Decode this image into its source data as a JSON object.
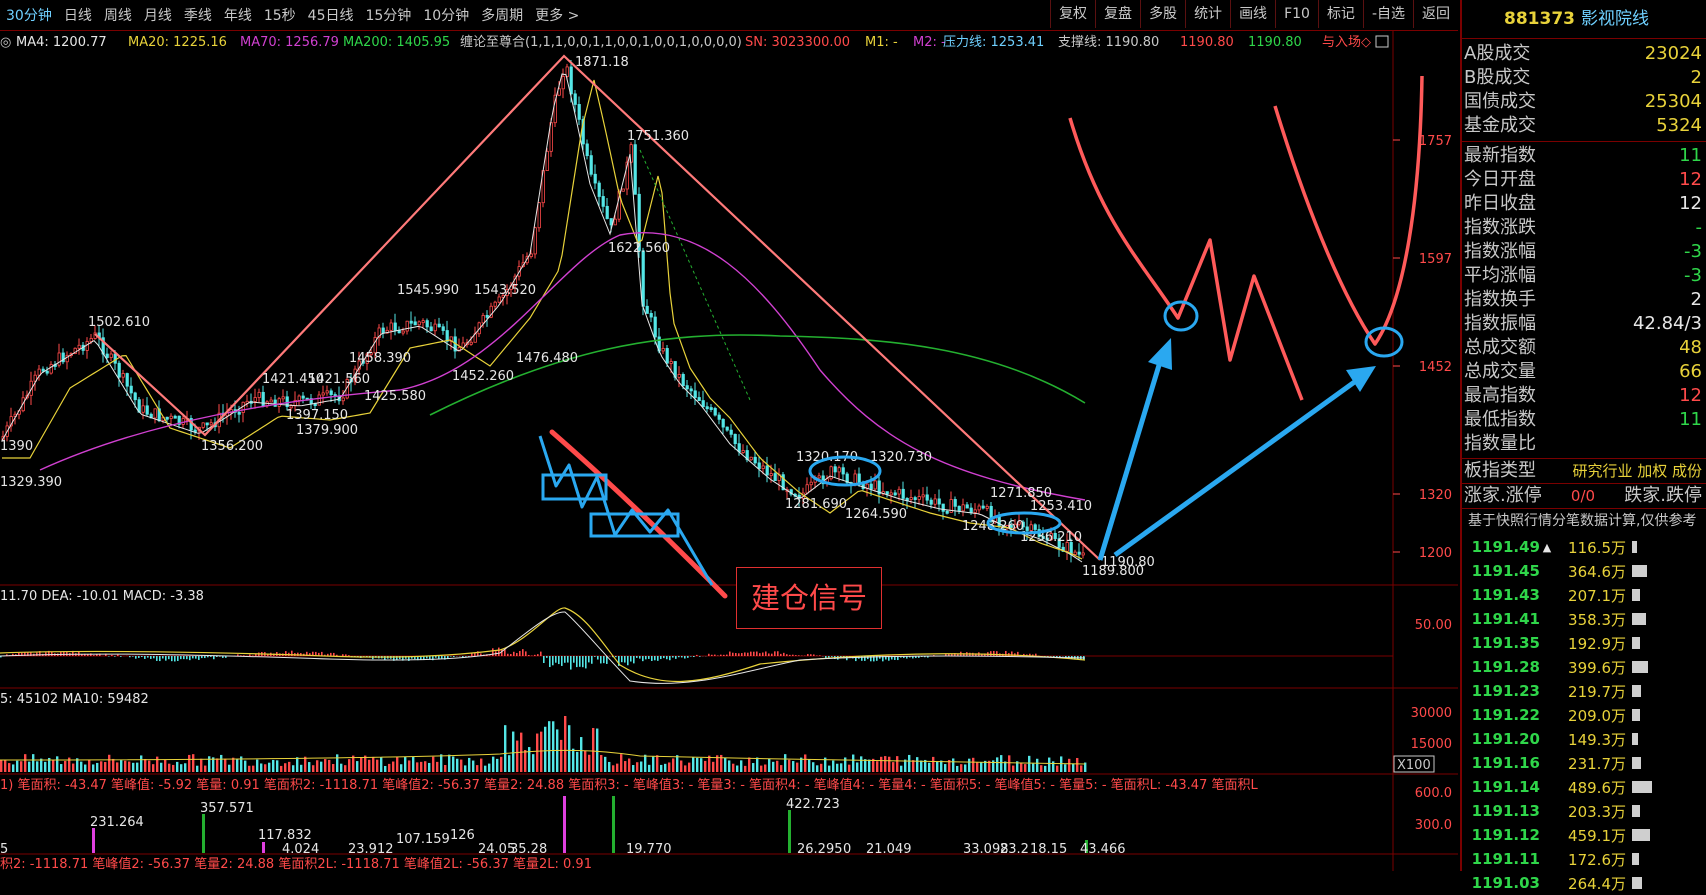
{
  "toolbar": {
    "timeframes": [
      "30分钟",
      "日线",
      "周线",
      "月线",
      "季线",
      "年线",
      "15秒",
      "45日线",
      "15分钟",
      "10分钟",
      "多周期",
      "更多 >"
    ],
    "tools": [
      "复权",
      "复盘",
      "多股",
      "统计",
      "画线",
      "F10",
      "标记",
      "-自选",
      "返回"
    ]
  },
  "indicators": {
    "ma4": "MA4: 1200.77",
    "ma20": "MA20: 1225.16",
    "ma70": "MA70: 1256.79",
    "ma200": "MA200: 1405.95",
    "chanlun": "缠论至尊合(1,1,1,0,0,1,1,0,0,1,0,0,1,0,0,0,0)",
    "sn": "SN: 3023300.00",
    "m1": "M1: -",
    "m2": "M2: -",
    "pressure": "压力线: 1253.41",
    "support": "支撑线: 1190.80",
    "v1": "1190.80",
    "v2": "1190.80",
    "entry": "与入场◇",
    "macd": "11.70 DEA: -10.01  MACD: -3.38",
    "vol": "5: 45102  MA10: 59482",
    "bi": "1)  笔面积: -43.47  笔峰值: -5.92  笔量: 0.91  笔面积2: -1118.71  笔峰值2: -56.37  笔量2: 24.88  笔面积3: -  笔峰值3: -  笔量3: -  笔面积4: -  笔峰值4: -  笔量4: -  笔面积5: -  笔峰值5: -  笔量5: -  笔面积L: -43.47  笔面积L",
    "bottom": "积2: -1118.71  笔峰值2: -56.37  笔量2: 24.88  笔面积2L: -1118.71  笔峰值2L: -56.37  笔量2L: 0.91"
  },
  "axis": {
    "price_ticks": [
      "1757",
      "1597",
      "1452",
      "1320",
      "1200"
    ],
    "macd_tick": "50.00",
    "vol_ticks": [
      "30000",
      "15000"
    ],
    "vol_unit": "X100",
    "bi_ticks": [
      "600.0",
      "300.0"
    ]
  },
  "price_labels": [
    "1871.18",
    "1751.360",
    "1622.560",
    "1545.990",
    "1543.520",
    "1502.610",
    "1458.390",
    "1476.480",
    "1452.260",
    "1425.580",
    "1421.450",
    "1421.560",
    "1397.150",
    "1379.900",
    "1356.200",
    "1390",
    "1329.390",
    "1320.170",
    "1320.730",
    "1281.690",
    "1264.590",
    "1271.850",
    "1253.410",
    "1248.260",
    "1236.210",
    "1190.80",
    "1189.800"
  ],
  "bi_labels": [
    "231.264",
    "357.571",
    "117.832",
    "4.024",
    "23.912",
    "107.159",
    "126",
    "24.05",
    "35.28",
    "422.723",
    "19.770",
    "26.295",
    "0",
    "21.049",
    "33.098",
    "23.2",
    "18.15",
    "43.466",
    "5"
  ],
  "annotation": {
    "signal": "建仓信号"
  },
  "right_panel": {
    "code": "881373",
    "name": "影视院线",
    "market": [
      {
        "label": "A股成交",
        "value": "23024",
        "color": "#e8d23a"
      },
      {
        "label": "B股成交",
        "value": "2",
        "color": "#e8d23a"
      },
      {
        "label": "国债成交",
        "value": "25304",
        "color": "#e8d23a"
      },
      {
        "label": "基金成交",
        "value": "5324",
        "color": "#e8d23a"
      }
    ],
    "index": [
      {
        "label": "最新指数",
        "value": "11",
        "color": "#2fd64a"
      },
      {
        "label": "今日开盘",
        "value": "12",
        "color": "#ff4a4a"
      },
      {
        "label": "昨日收盘",
        "value": "12",
        "color": "#e6e6e6"
      },
      {
        "label": "指数涨跌",
        "value": "-",
        "color": "#2fd64a"
      },
      {
        "label": "指数涨幅",
        "value": "-3",
        "color": "#2fd64a"
      },
      {
        "label": "平均涨幅",
        "value": "-3",
        "color": "#2fd64a"
      },
      {
        "label": "指数换手",
        "value": "2",
        "color": "#e6e6e6"
      },
      {
        "label": "指数振幅",
        "value": "42.84/3",
        "color": "#e6e6e6"
      },
      {
        "label": "总成交额",
        "value": "48",
        "color": "#e8d23a"
      },
      {
        "label": "总成交量",
        "value": "66",
        "color": "#e8d23a"
      },
      {
        "label": "最高指数",
        "value": "12",
        "color": "#ff4a4a"
      },
      {
        "label": "最低指数",
        "value": "11",
        "color": "#2fd64a"
      },
      {
        "label": "指数量比",
        "value": "",
        "color": "#e6e6e6"
      }
    ],
    "board_label": "板指类型",
    "board_value": "研究行业 加权 成份",
    "limit_label": "涨家.涨停",
    "limit_value": "0/0",
    "fall_label": "跌家.跌停",
    "note": "基于快照行情分笔数据计算,仅供参考",
    "ticks": [
      {
        "price": "1191.49",
        "vol": "116.5万",
        "bar": 0.12,
        "arrow": "▲"
      },
      {
        "price": "1191.45",
        "vol": "364.6万",
        "bar": 0.37,
        "arrow": ""
      },
      {
        "price": "1191.43",
        "vol": "207.1万",
        "bar": 0.21,
        "arrow": ""
      },
      {
        "price": "1191.41",
        "vol": "358.3万",
        "bar": 0.36,
        "arrow": ""
      },
      {
        "price": "1191.35",
        "vol": "192.9万",
        "bar": 0.2,
        "arrow": ""
      },
      {
        "price": "1191.28",
        "vol": "399.6万",
        "bar": 0.4,
        "arrow": ""
      },
      {
        "price": "1191.23",
        "vol": "219.7万",
        "bar": 0.22,
        "arrow": ""
      },
      {
        "price": "1191.22",
        "vol": "209.0万",
        "bar": 0.21,
        "arrow": ""
      },
      {
        "price": "1191.20",
        "vol": "149.3万",
        "bar": 0.15,
        "arrow": ""
      },
      {
        "price": "1191.16",
        "vol": "231.7万",
        "bar": 0.23,
        "arrow": ""
      },
      {
        "price": "1191.14",
        "vol": "489.6万",
        "bar": 0.49,
        "arrow": ""
      },
      {
        "price": "1191.13",
        "vol": "203.3万",
        "bar": 0.2,
        "arrow": ""
      },
      {
        "price": "1191.12",
        "vol": "459.1万",
        "bar": 0.46,
        "arrow": ""
      },
      {
        "price": "1191.11",
        "vol": "172.6万",
        "bar": 0.17,
        "arrow": ""
      },
      {
        "price": "1191.03",
        "vol": "264.4万",
        "bar": 0.26,
        "arrow": ""
      }
    ]
  }
}
